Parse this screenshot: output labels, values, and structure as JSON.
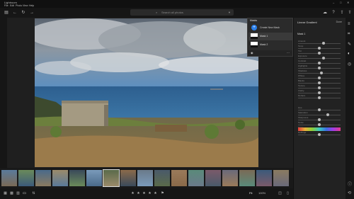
{
  "app": {
    "title": "Lightroom"
  },
  "menu": [
    "File",
    "Edit",
    "Photo",
    "View",
    "Help"
  ],
  "search": {
    "placeholder": "Search all photos"
  },
  "masks": {
    "header": "Masks",
    "create_label": "Create New Mask",
    "items": [
      "Mask 1",
      "Mask 2"
    ]
  },
  "panel": {
    "title": "Linear Gradient",
    "done": "Done",
    "section": "Mask 1",
    "sliders": [
      {
        "label": "Amount",
        "value": 60
      },
      {
        "label": "Temp",
        "value": 50
      },
      {
        "label": "Tint",
        "value": 50
      },
      {
        "label": "Exposure",
        "value": 60
      },
      {
        "label": "Contrast",
        "value": 50
      },
      {
        "label": "Highlights",
        "value": 50
      },
      {
        "label": "Shadows",
        "value": 55
      },
      {
        "label": "Whites",
        "value": 50
      },
      {
        "label": "Blacks",
        "value": 50
      },
      {
        "label": "Texture",
        "value": 50
      },
      {
        "label": "Clarity",
        "value": 50
      },
      {
        "label": "Dehaze",
        "value": 50
      },
      {
        "label": "Hue",
        "value": 50
      },
      {
        "label": "Saturation",
        "value": 70
      },
      {
        "label": "Sharpness",
        "value": 50
      },
      {
        "label": "Noise",
        "value": 50
      },
      {
        "label": "Moire",
        "value": 50
      },
      {
        "label": "Defringe",
        "value": 50
      }
    ]
  },
  "bottom": {
    "fit": "Fit",
    "zoom": "100%"
  },
  "filmstrip": {
    "count": 17
  },
  "colors": {
    "accent": "#2b7fe8",
    "panel": "#222222",
    "chrome": "#161616"
  }
}
